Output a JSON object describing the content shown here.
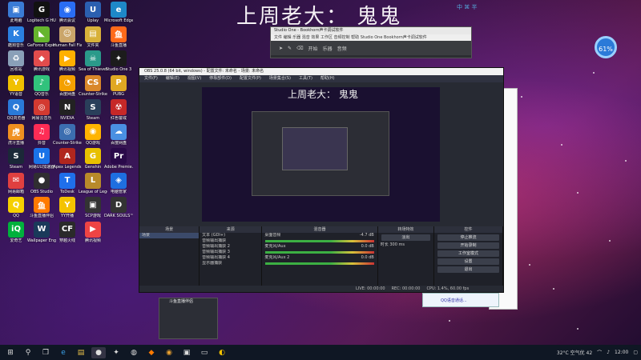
{
  "desktop": {
    "title": "上周老大： 鬼鬼",
    "badge": "61%",
    "ime": "中 ⌘ 半"
  },
  "desktop_icons": [
    {
      "label": "此电脑",
      "color": "#3a7bd5",
      "glyph": "▣"
    },
    {
      "label": "Logitech G HUB",
      "color": "#111111",
      "glyph": "G"
    },
    {
      "label": "腾讯会议",
      "color": "#2a6df4",
      "glyph": "◉"
    },
    {
      "label": "Uplay",
      "color": "#2b5fb0",
      "glyph": "U"
    },
    {
      "label": "Microsoft Edge",
      "color": "#1e88c8",
      "glyph": "e"
    },
    {
      "label": "酷狗音乐",
      "color": "#2a80e0",
      "glyph": "K"
    },
    {
      "label": "GeForce Experience",
      "color": "#66b52e",
      "glyph": "◣"
    },
    {
      "label": "Human Fall Flat",
      "color": "#caa56a",
      "glyph": "☺"
    },
    {
      "label": "文件夹",
      "color": "#d8b13a",
      "glyph": "▤"
    },
    {
      "label": "斗鱼直播",
      "color": "#ff6a1a",
      "glyph": "鱼"
    },
    {
      "label": "回收站",
      "color": "#8aa0b8",
      "glyph": "♻"
    },
    {
      "label": "腾讯游戏",
      "color": "#e24c4c",
      "glyph": "◆"
    },
    {
      "label": "腾讯视频",
      "color": "#ffb000",
      "glyph": "▶"
    },
    {
      "label": "Sea of Thieves",
      "color": "#2a9a8a",
      "glyph": "☠"
    },
    {
      "label": "Studio One 3",
      "color": "#1c1c1c",
      "glyph": "✦"
    },
    {
      "label": "YY语音",
      "color": "#f0c000",
      "glyph": "Y"
    },
    {
      "label": "QQ音乐",
      "color": "#31c27c",
      "glyph": "♪"
    },
    {
      "label": "百度网盘",
      "color": "#f4a000",
      "glyph": "◔"
    },
    {
      "label": "Counter-Strike",
      "color": "#d9872a",
      "glyph": "CS"
    },
    {
      "label": "PUBG",
      "color": "#e0a823",
      "glyph": "P"
    },
    {
      "label": "QQ浏览器",
      "color": "#2a7ad8",
      "glyph": "Q"
    },
    {
      "label": "网易云音乐",
      "color": "#d33a31",
      "glyph": "◎"
    },
    {
      "label": "NVIDIA",
      "color": "#222222",
      "glyph": "N"
    },
    {
      "label": "Steam",
      "color": "#2a3f5a",
      "glyph": "S"
    },
    {
      "label": "红色警戒",
      "color": "#c62828",
      "glyph": "☢"
    },
    {
      "label": "虎牙直播",
      "color": "#f09020",
      "glyph": "虎"
    },
    {
      "label": "抖音",
      "color": "#fe2c55",
      "glyph": "♫"
    },
    {
      "label": "Counter-Strike Global Off...",
      "color": "#3c6eb0",
      "glyph": "◎"
    },
    {
      "label": "QQ游戏",
      "color": "#ffb400",
      "glyph": "◉"
    },
    {
      "label": "百度网盘",
      "color": "#4a90e2",
      "glyph": "☁"
    },
    {
      "label": "Steam",
      "color": "#1b2838",
      "glyph": "S"
    },
    {
      "label": "网易UU加速器",
      "color": "#1a73e8",
      "glyph": "U"
    },
    {
      "label": "Apex Legends",
      "color": "#b0261e",
      "glyph": "A"
    },
    {
      "label": "Genshin",
      "color": "#e8c000",
      "glyph": "G"
    },
    {
      "label": "Adobe Premie...",
      "color": "#2a0a4a",
      "glyph": "Pr"
    },
    {
      "label": "网易邮箱",
      "color": "#e04040",
      "glyph": "✉"
    },
    {
      "label": "OBS Studio",
      "color": "#302e31",
      "glyph": "●"
    },
    {
      "label": "ToDesk",
      "color": "#1f6feb",
      "glyph": "T"
    },
    {
      "label": "League of Legends",
      "color": "#b88a2a",
      "glyph": "L"
    },
    {
      "label": "电脑管家",
      "color": "#1e6fe0",
      "glyph": "◈"
    },
    {
      "label": "QQ",
      "color": "#f6d000",
      "glyph": "Q"
    },
    {
      "label": "斗鱼直播伴侣",
      "color": "#ff7a00",
      "glyph": "鱼"
    },
    {
      "label": "YY开播",
      "color": "#f4c300",
      "glyph": "Y"
    },
    {
      "label": "SCP游戏",
      "color": "#333333",
      "glyph": "▣"
    },
    {
      "label": "DARK SOULS™ III",
      "color": "#333333",
      "glyph": "D"
    },
    {
      "label": "爱奇艺",
      "color": "#00b13c",
      "glyph": "iQ"
    },
    {
      "label": "Wallpaper Engine",
      "color": "#1a3a5a",
      "glyph": "W"
    },
    {
      "label": "穿越火线",
      "color": "#2a2a2a",
      "glyph": "CF"
    },
    {
      "label": "腾讯视频",
      "color": "#e44",
      "glyph": "▶"
    }
  ],
  "studio_one": {
    "title": "Studio One - Bookhorn声卡调试软件",
    "menu": "文件  编辑  乐器  混音  效果  工作区  音频控制  帮助  Studio One  Bookhorn声卡调试软件",
    "play_label": "开始",
    "mode_label": "乐器",
    "tool_label": "音频"
  },
  "obs": {
    "title": "OBS 25.0.8 (64 bit, windows) - 配置文件: 未命名 - 场景: 未命名",
    "menu": [
      "文件(F)",
      "编辑(E)",
      "视图(V)",
      "停靠部件(D)",
      "配置文件(P)",
      "场景集合(S)",
      "工具(T)",
      "帮助(H)"
    ],
    "preview_title": "上周老大： 鬼鬼",
    "docks": {
      "scenes": {
        "header": "场景",
        "items": [
          "场景"
        ]
      },
      "sources": {
        "header": "来源",
        "items": [
          "文本 (GDI+)",
          "音频输出捕获",
          "音频输出捕获 2",
          "音频输出捕获 3",
          "音频输出捕获 4",
          "显示器捕获"
        ]
      },
      "mixer": {
        "header": "混音器",
        "channels": [
          {
            "name": "桌面音频",
            "db": "-4.7 dB"
          },
          {
            "name": "麦克风/Aux",
            "db": "0.0 dB"
          },
          {
            "name": "麦克风/Aux 2",
            "db": "0.0 dB"
          }
        ]
      },
      "transitions": {
        "header": "转场特效",
        "type": "淡出",
        "duration_label": "时长",
        "duration_value": "300 ms"
      },
      "controls": {
        "header": "控件",
        "buttons": [
          "停止推流",
          "开始录制",
          "工作室模式",
          "设置",
          "退出"
        ]
      }
    },
    "status": {
      "live": "LIVE: 00:00:00",
      "rec": "REC: 00:00:00",
      "cpu": "CPU: 1.4%, 60.00 fps"
    }
  },
  "qq_popup": {
    "text": "QQ语音通话..."
  },
  "mini_window": {
    "title": "斗鱼直播伴侣"
  },
  "taskbar": {
    "icons": [
      "windows-start",
      "search",
      "task-view",
      "edge",
      "explorer",
      "obs",
      "studio-one",
      "steam",
      "douyu",
      "chrome",
      "media",
      "terminal",
      "qq"
    ],
    "tray": {
      "weather": "32°C 空气优 42",
      "time": "12:00"
    }
  }
}
